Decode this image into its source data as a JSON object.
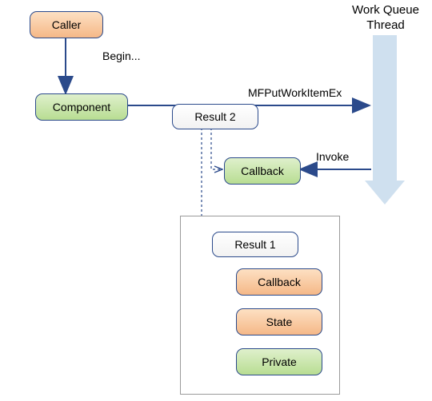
{
  "nodes": {
    "caller": "Caller",
    "component": "Component",
    "result2": "Result 2",
    "callback": "Callback",
    "result1": "Result 1",
    "r1_callback": "Callback",
    "r1_state": "State",
    "r1_private": "Private"
  },
  "edges": {
    "begin": "Begin...",
    "put": "MFPutWorkItemEx",
    "invoke": "Invoke"
  },
  "header": "Work Queue\nThread",
  "palette": {
    "orange_top": "#fde0c3",
    "orange_bot": "#f5b887",
    "green_top": "#dff0cc",
    "green_bot": "#b8dd92",
    "white_top": "#ffffff",
    "white_bot": "#f2f2f2",
    "stroke": "#2b4a8b",
    "arrow_fill": "#cfe0ef",
    "arrow_edge": "#b8cee4"
  }
}
